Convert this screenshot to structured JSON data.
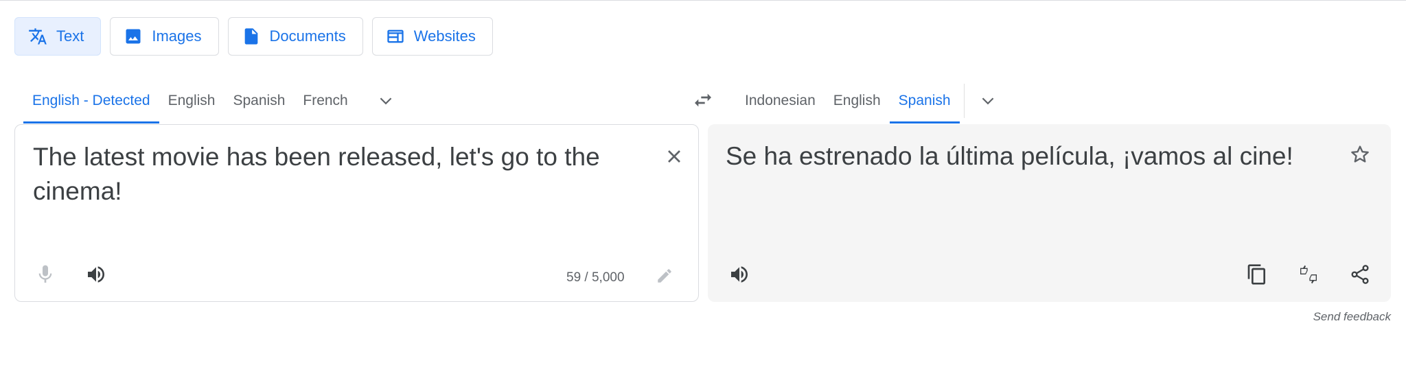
{
  "modes": [
    {
      "label": "Text",
      "icon": "translate-icon",
      "active": true
    },
    {
      "label": "Images",
      "icon": "image-icon",
      "active": false
    },
    {
      "label": "Documents",
      "icon": "document-icon",
      "active": false
    },
    {
      "label": "Websites",
      "icon": "website-icon",
      "active": false
    }
  ],
  "source_langs": [
    "English - Detected",
    "English",
    "Spanish",
    "French"
  ],
  "target_langs": [
    "Indonesian",
    "English",
    "Spanish"
  ],
  "source": {
    "text": "The latest movie has been released, let's go to the cinema!",
    "counter": "59 / 5,000"
  },
  "target": {
    "text": "Se ha estrenado la última película, ¡vamos al cine!"
  },
  "feedback": "Send feedback",
  "colors": {
    "accent": "#1a73e8",
    "target_bg": "#f5f5f5"
  }
}
